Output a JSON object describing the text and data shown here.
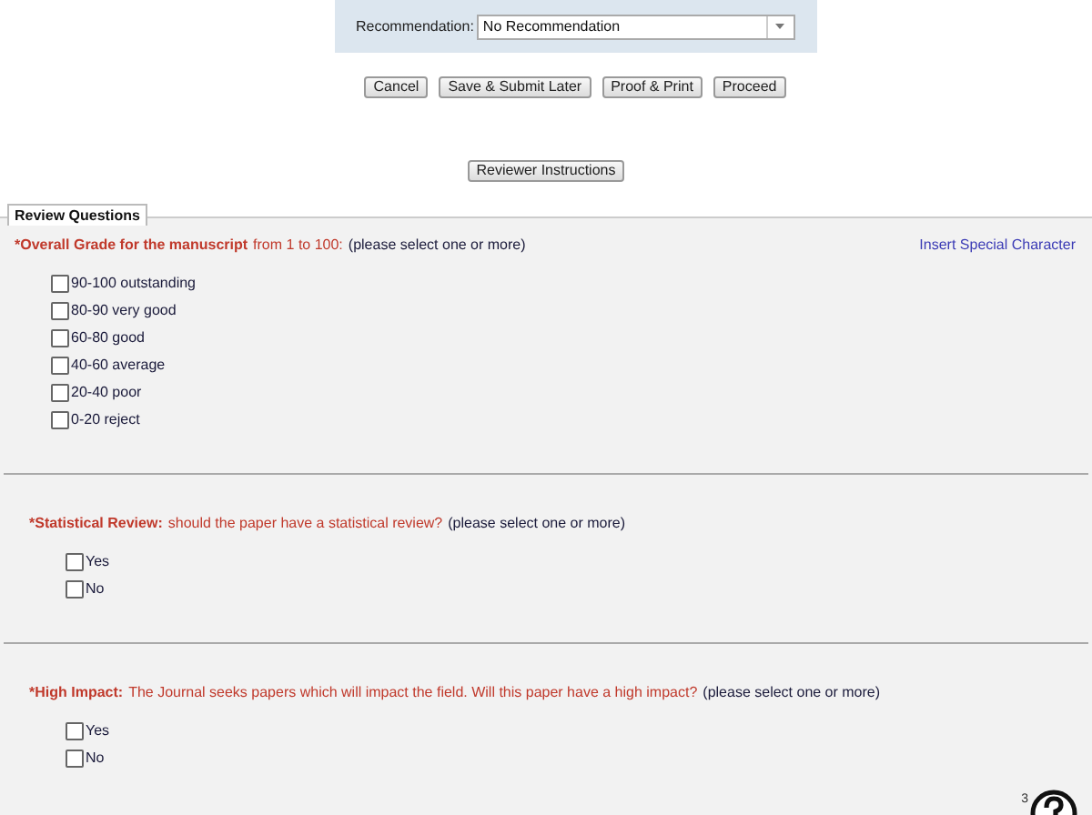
{
  "recommendation": {
    "label": "Recommendation:",
    "value": "No Recommendation"
  },
  "buttons": [
    "Cancel",
    "Save & Submit Later",
    "Proof & Print",
    "Proceed"
  ],
  "instructions_button": "Reviewer Instructions",
  "section": {
    "title": "Review Questions",
    "insert_link": "Insert Special Character"
  },
  "questions": [
    {
      "label": "*Overall Grade for the manuscript",
      "prompt": "from 1 to 100:",
      "hint": "(please select one or more)",
      "options": [
        {
          "label": "90-100 outstanding",
          "checked": false
        },
        {
          "label": "80-90 very good",
          "checked": false
        },
        {
          "label": "60-80 good",
          "checked": false
        },
        {
          "label": "40-60 average",
          "checked": false
        },
        {
          "label": "20-40 poor",
          "checked": false
        },
        {
          "label": "0-20 reject",
          "checked": false
        }
      ]
    },
    {
      "label": "*Statistical Review:",
      "prompt": "should the paper have a statistical review?",
      "hint": "(please select one or more)",
      "options": [
        {
          "label": "Yes",
          "checked": false
        },
        {
          "label": "No",
          "checked": false
        }
      ]
    },
    {
      "label": "*High Impact:",
      "prompt": "The Journal seeks papers which will impact the field. Will this paper have a high impact?",
      "hint": "(please select one or more)",
      "options": [
        {
          "label": "Yes",
          "checked": false
        },
        {
          "label": "No",
          "checked": false
        }
      ]
    }
  ],
  "help_badge": "3"
}
